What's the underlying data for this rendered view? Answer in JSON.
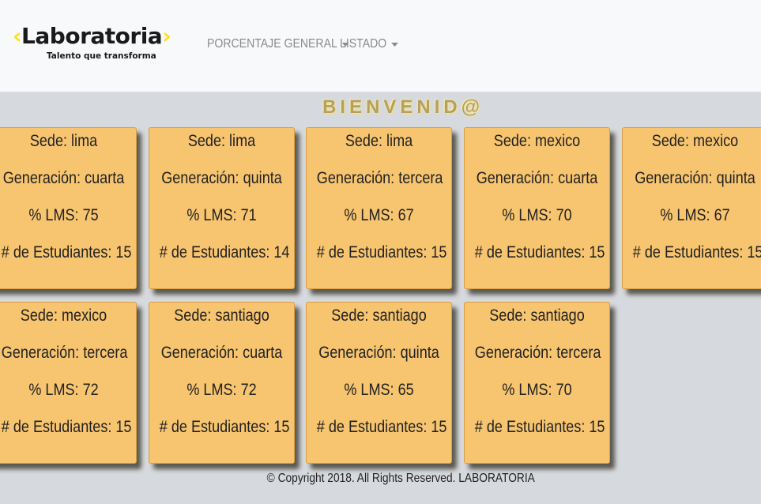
{
  "brand": {
    "open_bracket": "‹",
    "name": "Laboratoria",
    "close_bracket": "›",
    "tagline": "Talento que transforma",
    "accent_color": "#ffe017"
  },
  "nav": {
    "items": [
      {
        "label": "PORCENTAJE GENERAL"
      },
      {
        "label": "LISTADO"
      }
    ]
  },
  "welcome": "BIENVENID@",
  "cards": [
    {
      "sede": "Sede: lima",
      "generacion": "Generación: cuarta",
      "lms": "% LMS: 75",
      "estudiantes": "# de Estudiantes: 15"
    },
    {
      "sede": "Sede: lima",
      "generacion": "Generación: quinta",
      "lms": "% LMS: 71",
      "estudiantes": "# de Estudiantes: 14"
    },
    {
      "sede": "Sede: lima",
      "generacion": "Generación: tercera",
      "lms": "% LMS: 67",
      "estudiantes": "# de Estudiantes: 15"
    },
    {
      "sede": "Sede: mexico",
      "generacion": "Generación: cuarta",
      "lms": "% LMS: 70",
      "estudiantes": "# de Estudiantes: 15"
    },
    {
      "sede": "Sede: mexico",
      "generacion": "Generación: quinta",
      "lms": "% LMS: 67",
      "estudiantes": "# de Estudiantes: 15"
    },
    {
      "sede": "Sede: mexico",
      "generacion": "Generación: tercera",
      "lms": "% LMS: 72",
      "estudiantes": "# de Estudiantes: 15"
    },
    {
      "sede": "Sede: santiago",
      "generacion": "Generación: cuarta",
      "lms": "% LMS: 72",
      "estudiantes": "# de Estudiantes: 15"
    },
    {
      "sede": "Sede: santiago",
      "generacion": "Generación: quinta",
      "lms": "% LMS: 65",
      "estudiantes": "# de Estudiantes: 15"
    },
    {
      "sede": "Sede: santiago",
      "generacion": "Generación: tercera",
      "lms": "% LMS: 70",
      "estudiantes": "# de Estudiantes: 15"
    }
  ],
  "footer": "© Copyright 2018. All Rights Reserved. LABORATORIA",
  "colors": {
    "navbar_bg": "#f8f9fa",
    "page_bg": "#d6d9dd",
    "card_bg": "#f7c46f",
    "welcome_text": "#b5a060",
    "nav_text": "#8a8a8a"
  }
}
